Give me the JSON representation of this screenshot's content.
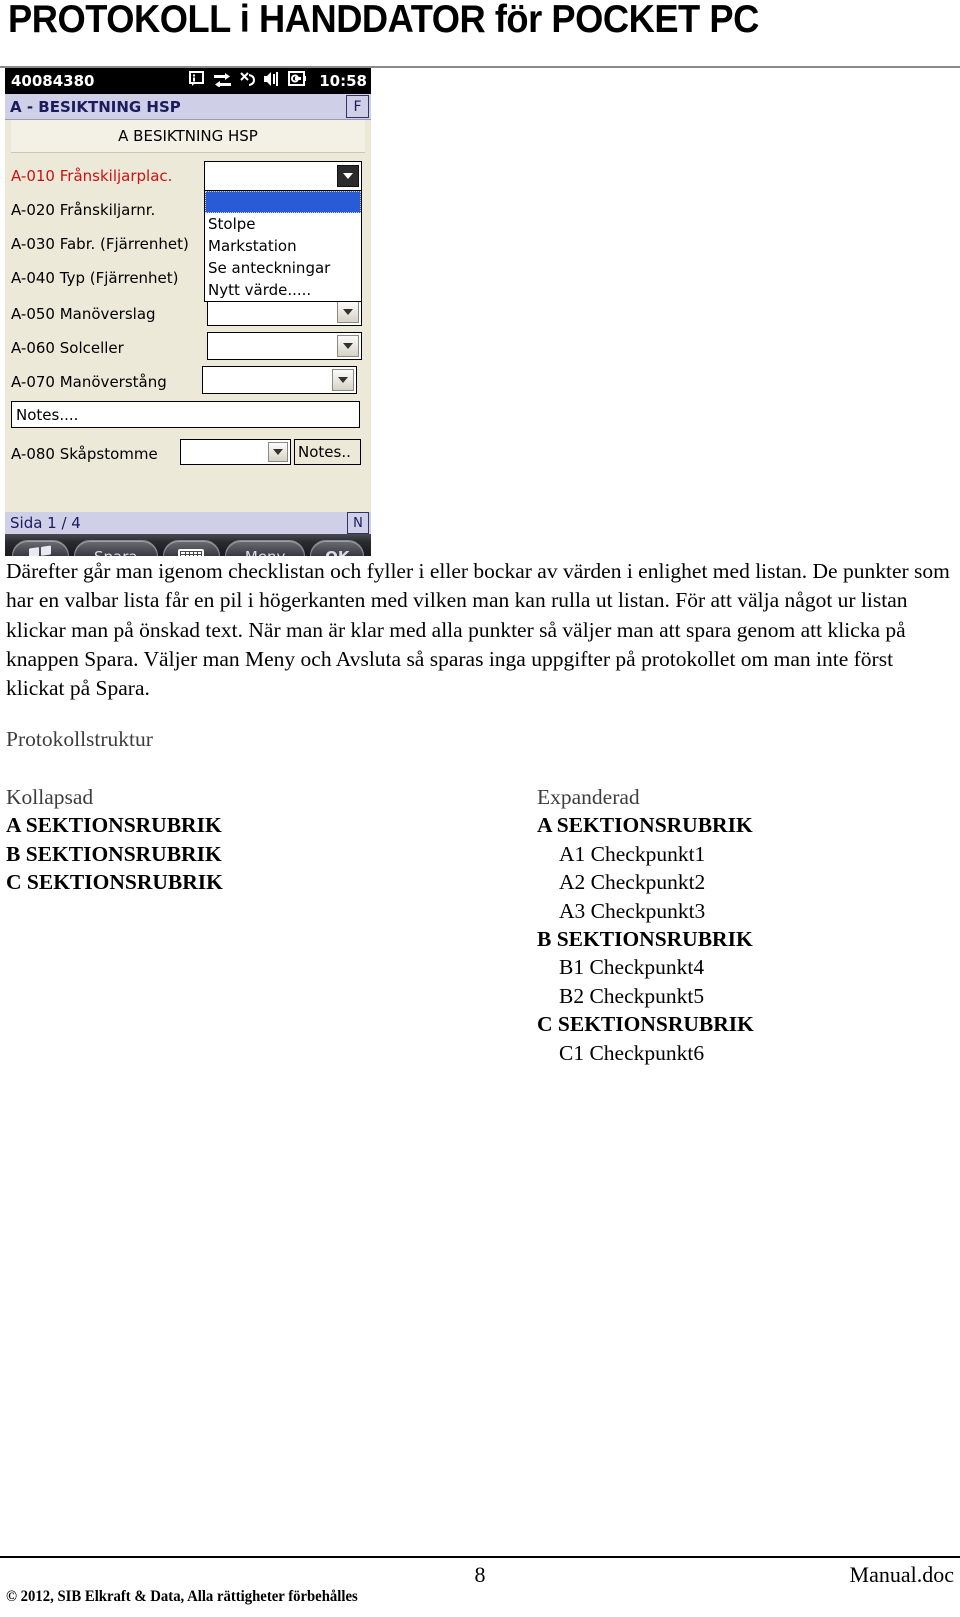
{
  "document": {
    "title": "PROTOKOLL i HANDDATOR för POCKET PC"
  },
  "pda": {
    "status_bar": {
      "client_id": "40084380",
      "clock": "10:58",
      "icons": [
        "notification-icon",
        "sync-icon",
        "wireless-off-icon",
        "speaker-icon",
        "battery-plug-icon"
      ]
    },
    "title_bar": {
      "title": "A - BESIKTNING HSP",
      "flag_button": "F"
    },
    "section_header": "A BESIKTNING HSP",
    "rows": [
      {
        "label": "A-010 Frånskiljarplac.",
        "active": true
      },
      {
        "label": "A-020 Frånskiljarnr.",
        "active": false
      },
      {
        "label": "A-030 Fabr. (Fjärrenhet)",
        "active": false
      },
      {
        "label": "A-040 Typ (Fjärrenhet)",
        "active": false
      },
      {
        "label": "A-050 Manöverslag",
        "active": false
      },
      {
        "label": "A-060 Solceller",
        "active": false
      },
      {
        "label": "A-070 Manöverstång",
        "active": false
      },
      {
        "label": "A-080 Skåpstomme",
        "active": false
      }
    ],
    "dropdown": {
      "selected_value": "",
      "options": [
        "",
        "Stolpe",
        "Markstation",
        "Se anteckningar",
        "Nytt värde....."
      ]
    },
    "notes_field": "Notes....",
    "notes_button": "Notes..",
    "page_bar": {
      "text": "Sida 1 / 4",
      "note_button": "N"
    },
    "toolbar": [
      {
        "name": "start-button",
        "label": "",
        "icon": "windows-flag-icon"
      },
      {
        "name": "save-button",
        "label": "Spara",
        "icon": ""
      },
      {
        "name": "keyboard-button",
        "label": "",
        "icon": "keyboard-icon"
      },
      {
        "name": "menu-button",
        "label": "Meny",
        "icon": ""
      },
      {
        "name": "ok-button",
        "label": "OK",
        "icon": ""
      }
    ]
  },
  "body": {
    "paragraph": "Därefter går man igenom checklistan och fyller i eller bockar av värden i enlighet med listan. De punkter som har en valbar lista får en pil i högerkanten med vilken man kan rulla ut listan. För att välja något ur listan klickar man på önskad text. När man är klar med alla punkter så väljer man att spara genom att klicka på knappen Spara. Väljer man Meny och Avsluta så sparas inga uppgifter på protokollet om man inte först klickat på Spara.",
    "section_heading": "Protokollstruktur",
    "structure": {
      "collapsed": {
        "caption": "Kollapsad",
        "lines": [
          {
            "text": "A SEKTIONSRUBRIK",
            "kind": "rub"
          },
          {
            "text": "B SEKTIONSRUBRIK",
            "kind": "rub"
          },
          {
            "text": "C SEKTIONSRUBRIK",
            "kind": "rub"
          }
        ]
      },
      "expanded": {
        "caption": "Expanderad",
        "lines": [
          {
            "text": "A SEKTIONSRUBRIK",
            "kind": "rub"
          },
          {
            "text": "A1 Checkpunkt1",
            "kind": "chk"
          },
          {
            "text": "A2 Checkpunkt2",
            "kind": "chk"
          },
          {
            "text": "A3 Checkpunkt3",
            "kind": "chk"
          },
          {
            "text": "B SEKTIONSRUBRIK",
            "kind": "rub"
          },
          {
            "text": "B1 Checkpunkt4",
            "kind": "chk"
          },
          {
            "text": "B2 Checkpunkt5",
            "kind": "chk"
          },
          {
            "text": "C SEKTIONSRUBRIK",
            "kind": "rub"
          },
          {
            "text": "C1 Checkpunkt6",
            "kind": "chk"
          }
        ]
      }
    }
  },
  "footer": {
    "page_number": "8",
    "document_name": "Manual.doc",
    "copyright": "© 2012, SIB Elkraft & Data, Alla rättigheter förbehålles"
  }
}
